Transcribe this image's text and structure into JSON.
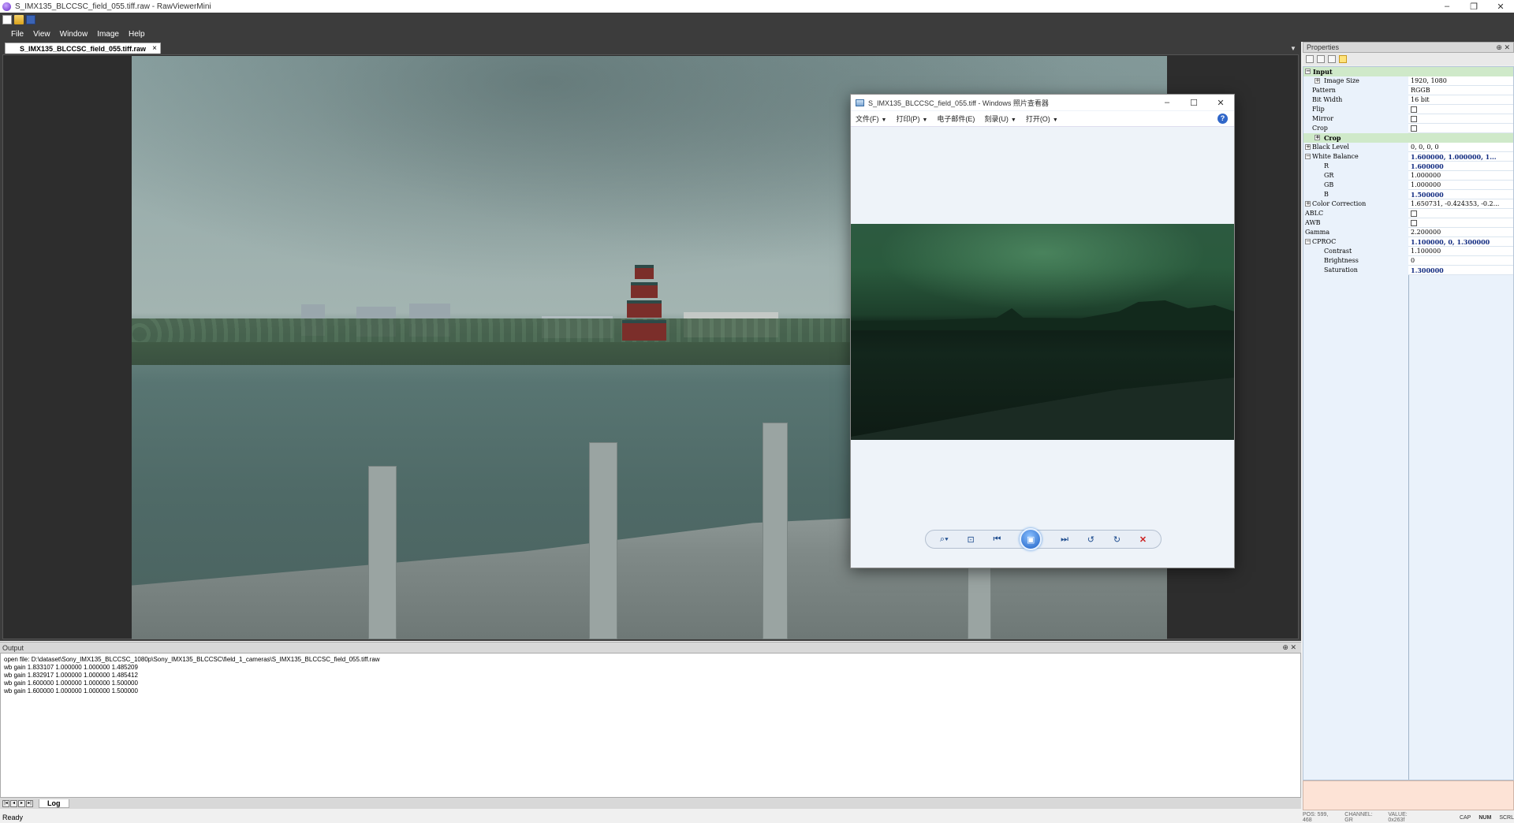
{
  "window": {
    "title": "S_IMX135_BLCCSC_field_055.tiff.raw - RawViewerMini",
    "buttons": [
      "–",
      "❐",
      "✕"
    ]
  },
  "menu": [
    "File",
    "View",
    "Window",
    "Image",
    "Help"
  ],
  "document": {
    "tab_label": "S_IMX135_BLCCSC_field_055.tiff.raw",
    "tab_close": "×"
  },
  "viewer": {
    "title": "S_IMX135_BLCCSC_field_055.tiff - Windows 照片查看器",
    "menu": {
      "file": "文件(F)",
      "print": "打印(P)",
      "email": "电子邮件(E)",
      "burn": "刻录(U)",
      "open": "打开(O)"
    },
    "help": "?",
    "icons": [
      "zoom-icon",
      "fit-icon",
      "previous-icon",
      "slideshow-icon",
      "next-icon",
      "rotate-left-icon",
      "rotate-right-icon",
      "delete-icon"
    ]
  },
  "output": {
    "title": "Output",
    "header_buttons": "⊕ ✕",
    "lines": [
      "open file: D:\\dataset\\Sony_IMX135_BLCCSC_1080p\\Sony_IMX135_BLCCSC\\field_1_cameras\\S_IMX135_BLCCSC_field_055.tiff.raw",
      "wb gain 1.833107 1.000000 1.000000 1.485209",
      "wb gain 1.832917 1.000000 1.000000 1.485412",
      "wb gain 1.600000 1.000000 1.000000 1.500000",
      "wb gain 1.600000 1.000000 1.000000 1.500000"
    ],
    "log_tab": "Log"
  },
  "properties": {
    "title": "Properties",
    "header_buttons": "⊕ ✕",
    "rows": [
      {
        "name": "Input",
        "value": "",
        "kind": "cat",
        "toggle": "−"
      },
      {
        "name": "Image Size",
        "value": "1920, 1080",
        "kind": "sub",
        "toggle": "+"
      },
      {
        "name": "Pattern",
        "value": "RGGB",
        "kind": "child"
      },
      {
        "name": "Bit Width",
        "value": "16 bit",
        "kind": "child"
      },
      {
        "name": "Flip",
        "value": "",
        "kind": "child",
        "check": true
      },
      {
        "name": "Mirror",
        "value": "",
        "kind": "child",
        "check": true
      },
      {
        "name": "Crop",
        "value": "",
        "kind": "child",
        "check": true
      },
      {
        "name": "Crop",
        "value": "",
        "kind": "cat",
        "toggle": "+"
      },
      {
        "name": "Black Level",
        "value": "0, 0, 0, 0",
        "kind": "top",
        "toggle": "+"
      },
      {
        "name": "White Balance",
        "value": "1.600000, 1.000000, 1...",
        "kind": "top",
        "toggle": "−",
        "bold": true
      },
      {
        "name": "R",
        "value": "1.600000",
        "kind": "sub",
        "bold": true
      },
      {
        "name": "GR",
        "value": "1.000000",
        "kind": "sub"
      },
      {
        "name": "GB",
        "value": "1.000000",
        "kind": "sub"
      },
      {
        "name": "B",
        "value": "1.500000",
        "kind": "sub",
        "bold": true
      },
      {
        "name": "Color Correction",
        "value": "1.650731, -0.424353, -0.2...",
        "kind": "top",
        "toggle": "+"
      },
      {
        "name": "ABLC",
        "value": "",
        "kind": "plain",
        "check": true
      },
      {
        "name": "AWB",
        "value": "",
        "kind": "plain",
        "check": true
      },
      {
        "name": "Gamma",
        "value": "2.200000",
        "kind": "plain"
      },
      {
        "name": "CPROC",
        "value": "1.100000, 0, 1.300000",
        "kind": "top",
        "toggle": "−",
        "bold": true
      },
      {
        "name": "Contrast",
        "value": "1.100000",
        "kind": "sub"
      },
      {
        "name": "Brightness",
        "value": "0",
        "kind": "sub"
      },
      {
        "name": "Saturation",
        "value": "1.300000",
        "kind": "sub",
        "bold": true
      }
    ]
  },
  "status": {
    "text": "Ready",
    "pos": "POS: 599, 468",
    "channel": "CHANNEL: GR",
    "value": "VALUE: 0x263f",
    "indicators": [
      "CAP",
      "NUM",
      "SCRL"
    ]
  }
}
